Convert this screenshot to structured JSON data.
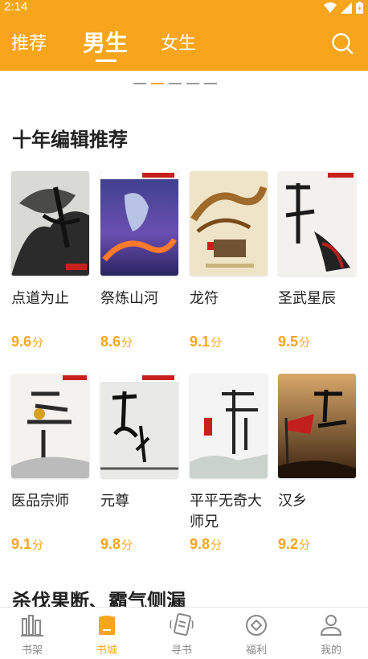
{
  "status_bar": {
    "time": "2:14"
  },
  "header": {
    "tabs": [
      {
        "label": "推荐",
        "active": false
      },
      {
        "label": "男生",
        "active": true
      },
      {
        "label": "女生",
        "active": false
      }
    ]
  },
  "colors": {
    "accent": "#f7a51c",
    "text": "#222222",
    "muted": "#888888"
  },
  "carousel": {
    "page_count": 5,
    "active_index": 1
  },
  "sections": [
    {
      "title": "十年编辑推荐",
      "books": [
        {
          "title": "点道为止",
          "score": "9.6",
          "unit": "分"
        },
        {
          "title": "祭炼山河",
          "score": "8.6",
          "unit": "分"
        },
        {
          "title": "龙符",
          "score": "9.1",
          "unit": "分"
        },
        {
          "title": "圣武星辰",
          "score": "9.5",
          "unit": "分"
        },
        {
          "title": "医品宗师",
          "score": "9.1",
          "unit": "分"
        },
        {
          "title": "元尊",
          "score": "9.8",
          "unit": "分"
        },
        {
          "title": "平平无奇大师兄",
          "score": "9.8",
          "unit": "分"
        },
        {
          "title": "汉乡",
          "score": "9.2",
          "unit": "分"
        }
      ]
    },
    {
      "title": "杀伐果断、霸气侧漏"
    }
  ],
  "bottom_nav": [
    {
      "label": "书架",
      "icon": "bookshelf-icon",
      "active": false
    },
    {
      "label": "书城",
      "icon": "bookstore-icon",
      "active": true
    },
    {
      "label": "寻书",
      "icon": "find-book-icon",
      "active": false
    },
    {
      "label": "福利",
      "icon": "welfare-icon",
      "active": false
    },
    {
      "label": "我的",
      "icon": "profile-icon",
      "active": false
    }
  ]
}
